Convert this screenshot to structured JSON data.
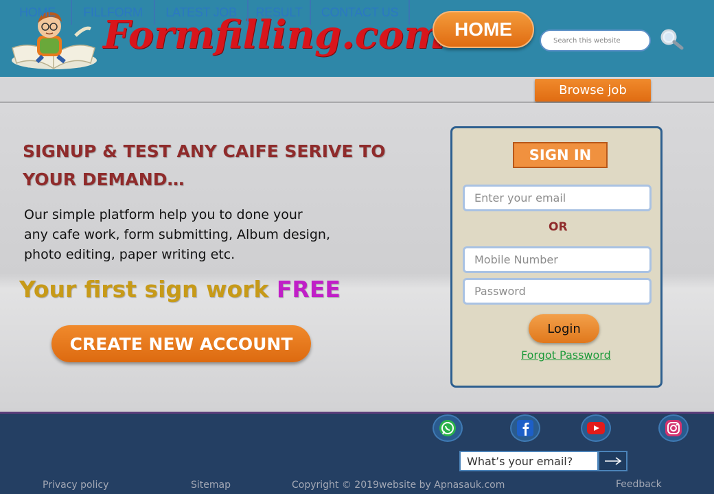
{
  "header": {
    "logo_text": "Formfilling.com",
    "home_label": "HOME",
    "search_placeholder": "Search this website",
    "icons": {
      "logo": "boy-reading-book-icon",
      "search": "magnifier-icon"
    }
  },
  "nav": {
    "items": [
      {
        "label": "HOME"
      },
      {
        "label": "FILLFORM"
      },
      {
        "label": "LATEST JOB"
      },
      {
        "label": "RESULT"
      },
      {
        "label": "CONTACT US"
      }
    ],
    "browse_label": "Browse job"
  },
  "hero": {
    "headline": "SIGNUP & TEST ANY CAIFE SERIVE TO YOUR DEMAND…",
    "description": " Our simple platform help you to done your\nany cafe work, form submitting, Album design,\nphoto editing, paper writing etc.",
    "free_prefix": "Your first sign work ",
    "free_word": "FREE",
    "create_label": "CREATE NEW ACCOUNT"
  },
  "signin": {
    "title": "SIGN IN",
    "email_placeholder": "Enter your email",
    "or_text": "OR",
    "mobile_placeholder": "Mobile Number",
    "password_placeholder": "Password",
    "login_label": "Login",
    "forgot_label": "Forgot Password"
  },
  "footer": {
    "social": [
      "whatsapp-icon",
      "facebook-icon",
      "youtube-icon",
      "instagram-icon"
    ],
    "email_placeholder": "What’s your email?",
    "privacy": "Privacy policy",
    "sitemap": "Sitemap",
    "copyright": "Copyright © 2019website by Apnasauk.com",
    "feedback": "Feedback"
  },
  "colors": {
    "header_bg": "#2e87a8",
    "logo_red": "#d8151b",
    "accent_orange": "#e97a20",
    "nav_text": "#2b78c2",
    "headline": "#8f2b2b",
    "free_gold": "#c79a18",
    "free_magenta": "#c01fc7",
    "footer_bg": "#243f63",
    "link_green": "#1d9a3a"
  }
}
